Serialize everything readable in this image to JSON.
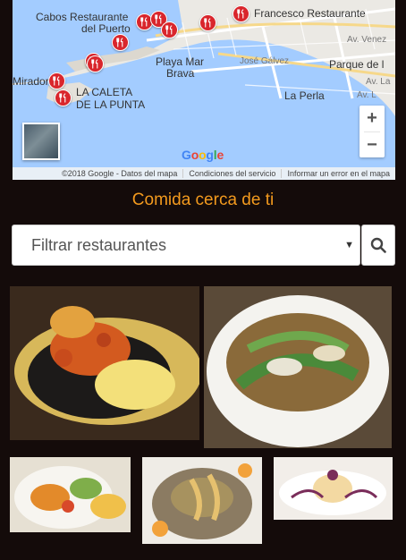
{
  "map": {
    "labels": {
      "cabos": "Cabos Restaurante",
      "puerto": "del Puerto",
      "francesco": "Francesco Restaurante",
      "venezuela": "Av. Venez",
      "mirador": "Mirador",
      "caleta1": "LA CALETA",
      "caleta2": "DE LA PUNTA",
      "playa1": "Playa Mar",
      "playa2": "Brava",
      "galvez": "José Gálvez",
      "parque": "Parque de l",
      "la_perla": "La Perla",
      "av1": "Av. La",
      "av2": "Av. L"
    },
    "zoom_in": "+",
    "zoom_out": "−",
    "logo": "Google",
    "attribution": {
      "copyright": "©2018 Google - Datos del mapa",
      "terms": "Condiciones del servicio",
      "report": "Informar un error en el mapa"
    }
  },
  "section_title": "Comida cerca de ti",
  "filter": {
    "placeholder": "Filtrar restaurantes"
  },
  "icons": {
    "pin": "restaurant-pin-icon",
    "search": "search-icon",
    "caret": "caret-down-icon"
  },
  "colors": {
    "accent": "#f39a1e",
    "background": "#140b0a",
    "pin": "#d9262c",
    "sea": "#a3ccff"
  }
}
